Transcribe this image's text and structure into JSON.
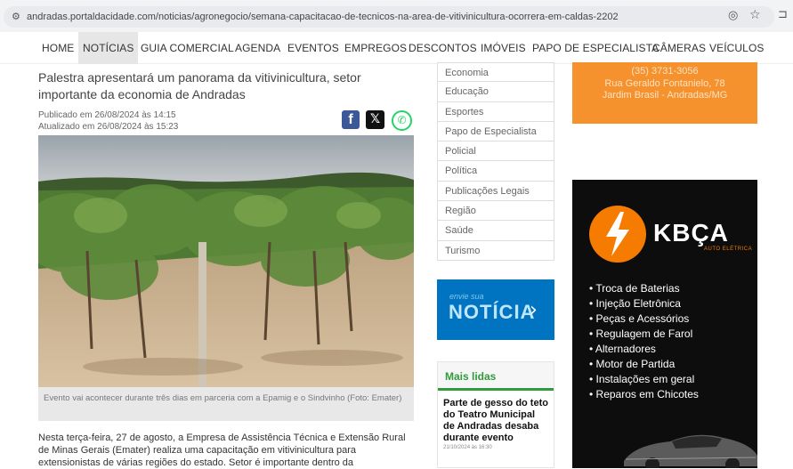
{
  "browser": {
    "url": "andradas.portaldacidade.com/noticias/agronegocio/semana-capacitacao-de-tecnicos-na-area-de-vitivinicultura-ocorrera-em-caldas-2202",
    "icons": [
      "site-info-icon",
      "eye-off-icon",
      "star-icon",
      "extensions-icon"
    ]
  },
  "nav": {
    "items": [
      "HOME",
      "NOTÍCIAS",
      "GUIA COMERCIAL",
      "AGENDA",
      "EVENTOS",
      "EMPREGOS",
      "DESCONTOS",
      "IMÓVEIS",
      "PAPO DE ESPECIALISTA",
      "CÂMERAS",
      "VEÍCULOS"
    ],
    "active": "NOTÍCIAS"
  },
  "article": {
    "lead": "Palestra apresentará um panorama da vitivinicultura, setor importante da economia de Andradas",
    "published": "Publicado em 26/08/2024 às 14:15",
    "updated": "Atualizado em 26/08/2024 às 15:23",
    "caption": "Evento vai acontecer durante três dias em parceria com a Epamig e o Sindvinho (Foto: Emater)",
    "body": "Nesta terça-feira, 27 de agosto, a Empresa de Assistência Técnica e Extensão Rural de Minas Gerais (Emater) realiza uma capacitação em vitivinicultura para extensionistas de várias regiões do estado. Setor é importante dentro da"
  },
  "share": {
    "icons": [
      "facebook-icon",
      "x-icon",
      "whatsapp-icon"
    ]
  },
  "categories": [
    "Economia",
    "Educação",
    "Esportes",
    "Papo de Especialista",
    "Policial",
    "Política",
    "Publicações Legais",
    "Região",
    "Saúde",
    "Turismo"
  ],
  "envie": {
    "small": "envie sua",
    "word": "NOTÍCIA",
    "arrow": "›"
  },
  "mais_lidas": {
    "heading": "Mais lidas",
    "title": "Parte de gesso do teto do Teatro Municipal de Andradas desaba durante evento",
    "date": "21/10/2024 às 16:30"
  },
  "ad_top": {
    "lines": [
      "(35) 3731-3056",
      "Rua Geraldo Fontanielo, 78",
      "Jardim Brasil - Andradas/MG"
    ]
  },
  "ad_kbca": {
    "brand": "KBÇA",
    "subtitle": "AUTO ELÉTRICA",
    "services": [
      "Troca de Baterias",
      "Injeção Eletrônica",
      "Peças e Acessórios",
      "Regulagem de Farol",
      "Alternadores",
      "Motor de Partida",
      "Instalações em geral",
      "Reparos em Chicotes"
    ],
    "accent": "#f57c00"
  },
  "colors": {
    "accent_green": "#2f9b3a",
    "envie_blue": "#0074c1",
    "ad_orange": "#f5922d"
  }
}
